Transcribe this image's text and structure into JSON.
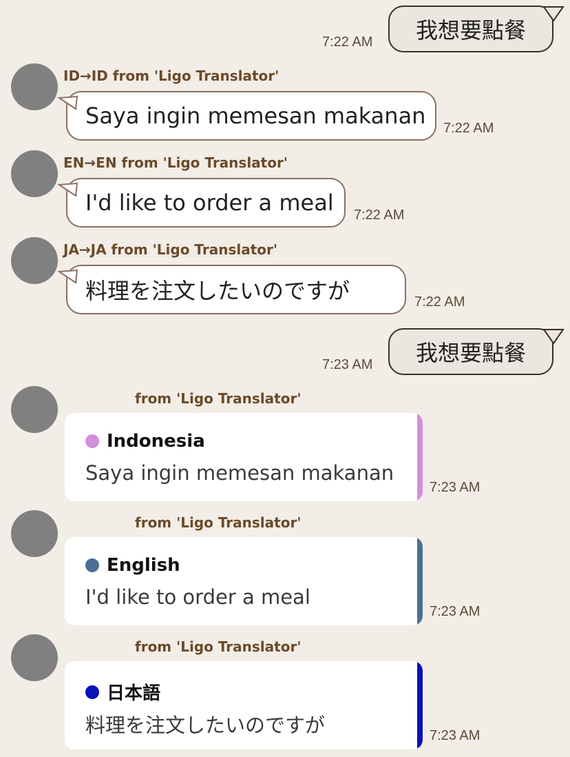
{
  "messages": [
    {
      "text": "我想要點餐",
      "time": "7:22 AM"
    },
    {
      "sender": "ID→ID from 'Ligo Translator'",
      "text": "Saya ingin memesan makanan",
      "time": "7:22 AM"
    },
    {
      "sender": "EN→EN from 'Ligo Translator'",
      "text": "I'd like to order a meal",
      "time": "7:22 AM"
    },
    {
      "sender": "JA→JA from 'Ligo Translator'",
      "text": "料理を注文したいのですが",
      "time": "7:22 AM"
    },
    {
      "text": "我想要點餐",
      "time": "7:23 AM"
    }
  ],
  "cards": [
    {
      "sender": "from 'Ligo Translator'",
      "language": "Indonesia",
      "text": "Saya ingin memesan makanan",
      "time": "7:23 AM",
      "accent": "#d58ddd"
    },
    {
      "sender": "from 'Ligo Translator'",
      "language": "English",
      "text": "I'd like to order a meal",
      "time": "7:23 AM",
      "accent": "#4a6f95"
    },
    {
      "sender": "from 'Ligo Translator'",
      "language": "日本語",
      "text": "料理を注文したいのですが",
      "time": "7:23 AM",
      "accent": "#0a12b8"
    }
  ]
}
